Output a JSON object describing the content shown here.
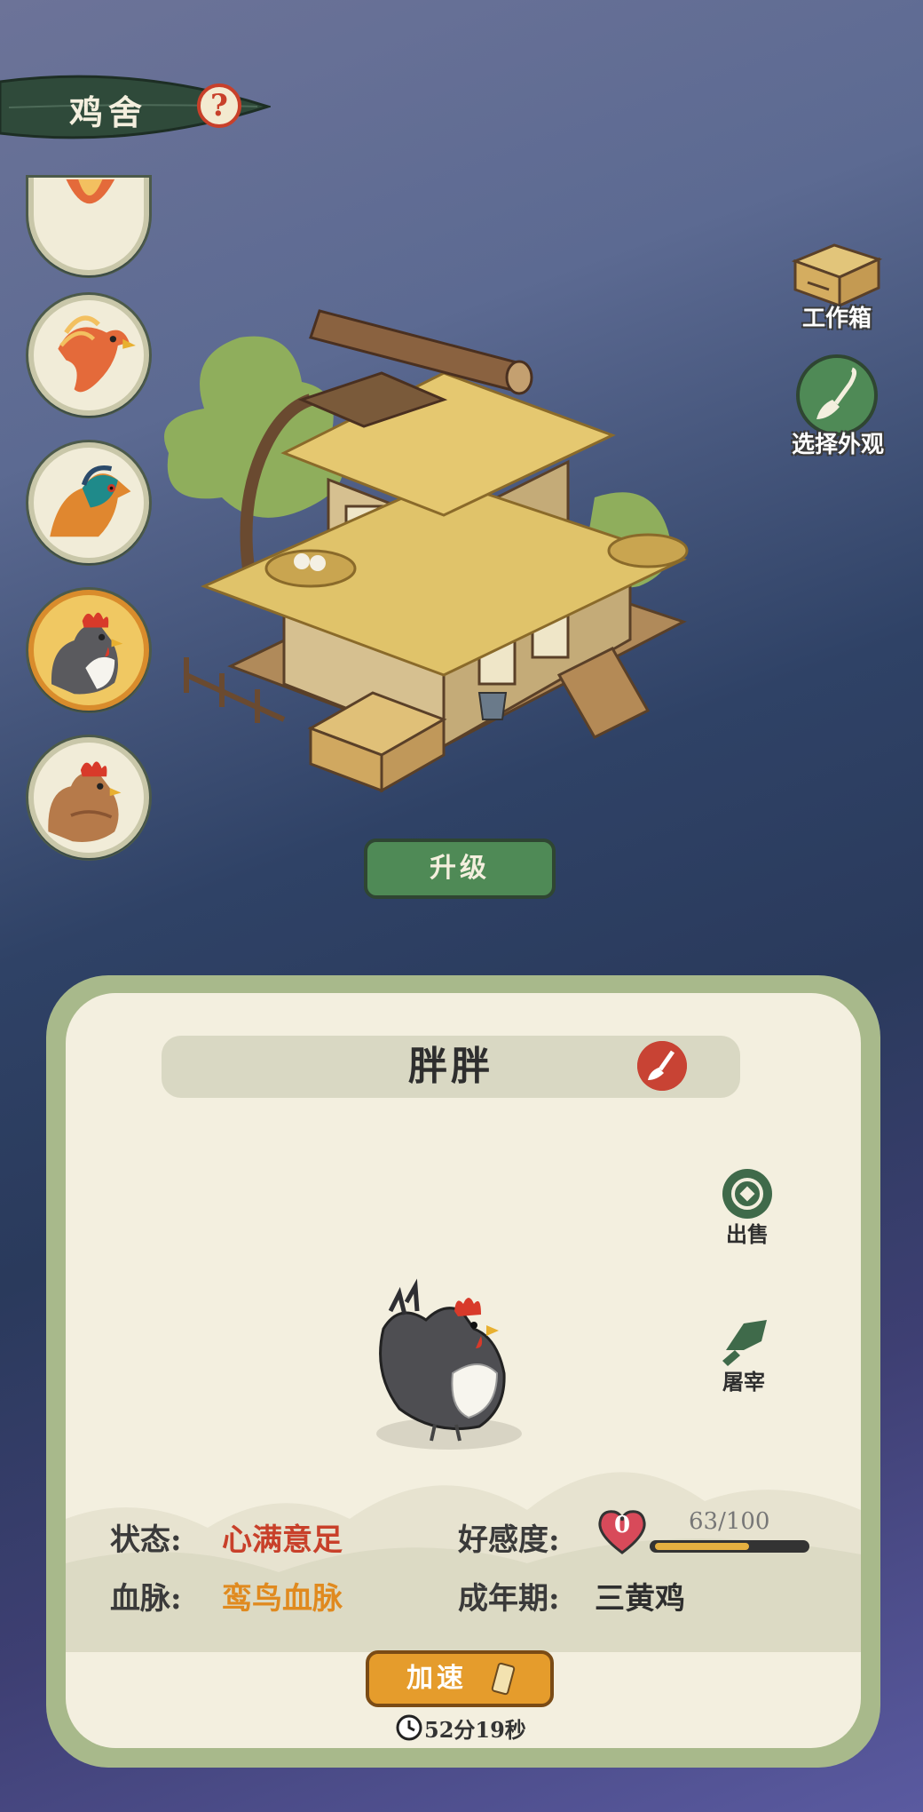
{
  "header": {
    "title": "鸡舍",
    "help_glyph": "?"
  },
  "avatars": [
    {
      "name": "phoenix-partial",
      "selected": false
    },
    {
      "name": "phoenix",
      "selected": false
    },
    {
      "name": "peacock-pheasant",
      "selected": false
    },
    {
      "name": "black-hen",
      "selected": true
    },
    {
      "name": "brown-hen",
      "selected": false
    }
  ],
  "side": {
    "workbox_label": "工作箱",
    "appearance_label": "选择外观"
  },
  "upgrade_label": "升级",
  "panel": {
    "name": "胖胖",
    "sell_label": "出售",
    "slaughter_label": "屠宰",
    "status_label": "状态:",
    "status_value": "心满意足",
    "affinity_label": "好感度:",
    "affinity_level": "0",
    "affinity_progress": "63/100",
    "affinity_fraction": 0.63,
    "bloodline_label": "血脉:",
    "bloodline_value": "鸾鸟血脉",
    "adult_label": "成年期:",
    "adult_value": "三黄鸡",
    "speed_label": "加速",
    "timer": "52分19秒"
  },
  "colors": {
    "status": "#c8402a",
    "bloodline": "#e08a1f",
    "accent_green": "#4f8a56",
    "speed": "#e59c2c"
  }
}
